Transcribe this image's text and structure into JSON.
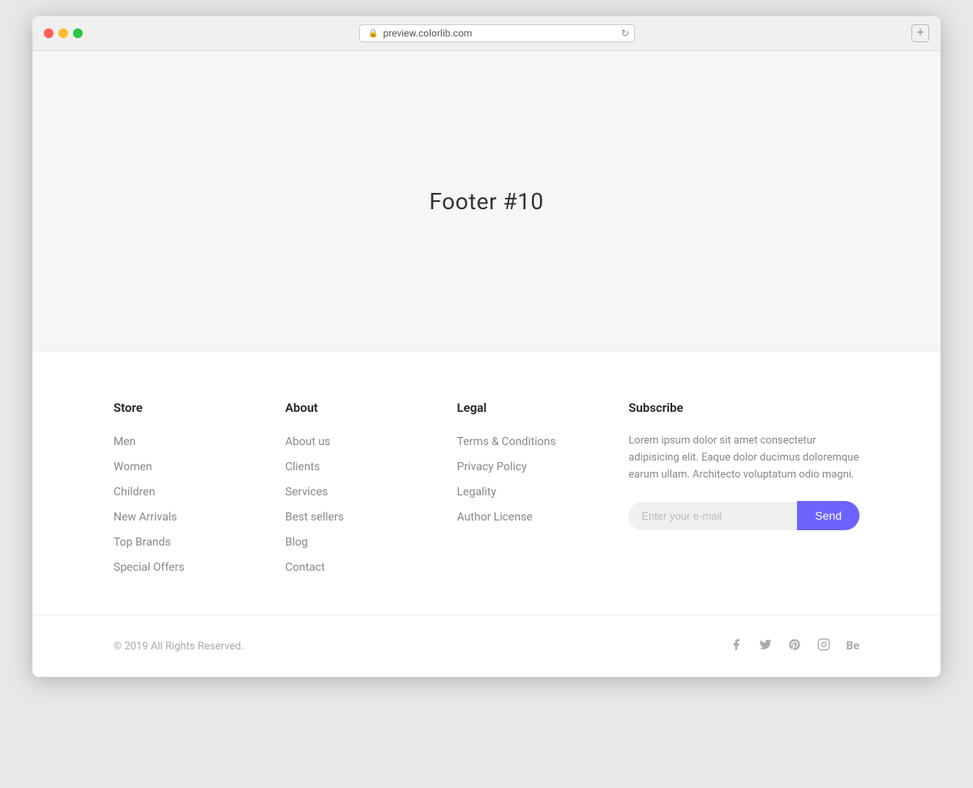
{
  "browser": {
    "url": "preview.colorlib.com",
    "new_tab_label": "+"
  },
  "page": {
    "title": "Footer #10"
  },
  "footer": {
    "store": {
      "heading": "Store",
      "links": [
        "Men",
        "Women",
        "Children",
        "New Arrivals",
        "Top Brands",
        "Special Offers"
      ]
    },
    "about": {
      "heading": "About",
      "links": [
        "About us",
        "Clients",
        "Services",
        "Best sellers",
        "Blog",
        "Contact"
      ]
    },
    "legal": {
      "heading": "Legal",
      "links": [
        "Terms & Conditions",
        "Privacy Policy",
        "Legality",
        "Author License"
      ]
    },
    "subscribe": {
      "heading": "Subscribe",
      "description": "Lorem ipsum dolor sit amet consectetur adipisicing elit. Eaque dolor ducimus doloremque earum ullam. Architecto voluptatum odio magni.",
      "email_placeholder": "Enter your e-mail",
      "send_label": "Send"
    },
    "bottom": {
      "copyright": "© 2019 All Rights Reserved."
    }
  }
}
